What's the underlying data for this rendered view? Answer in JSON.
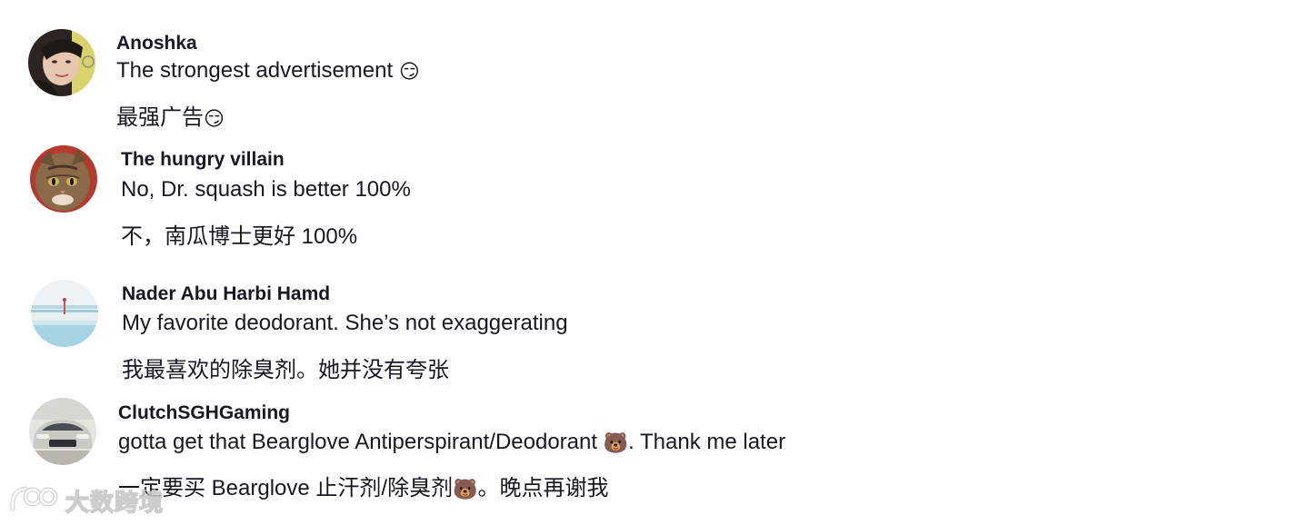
{
  "comments": [
    {
      "username": "Anoshka",
      "text": "The strongest advertisement",
      "text_emoji": "😏",
      "translation": "最强广告",
      "translation_emoji": "😏",
      "avatar_icon": "user-photo-avatar"
    },
    {
      "username": "The hungry villain",
      "text": "No, Dr. squash is better 100%",
      "translation": "不，南瓜博士更好 100%",
      "avatar_icon": "cat-photo-avatar"
    },
    {
      "username": "Nader Abu Harbi Hamd",
      "text": "My favorite deodorant. She’s not exaggerating",
      "translation": "我最喜欢的除臭剂。她并没有夸张",
      "avatar_icon": "beach-photo-avatar"
    },
    {
      "username": "ClutchSGHGaming",
      "text_before": "gotta get that Bearglove Antiperspirant/Deodorant",
      "text_emoji": "🐻",
      "text_after": ". Thank me later",
      "translation_before": "一定要买 Bearglove 止汗剂/除臭剂",
      "translation_emoji": "🐻",
      "translation_after": "。晚点再谢我",
      "avatar_icon": "car-photo-avatar"
    }
  ],
  "watermark": {
    "text": "大数跨境",
    "icon": "logo-icon"
  },
  "colors": {
    "text": "#161823",
    "background": "#ffffff"
  }
}
